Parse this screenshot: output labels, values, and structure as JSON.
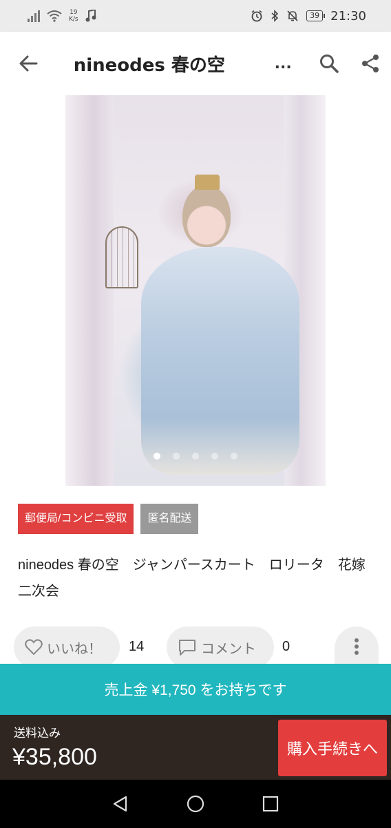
{
  "status_bar": {
    "net_speed_value": "19",
    "net_speed_unit": "K/s",
    "battery": "39",
    "time": "21:30",
    "icons": [
      "signal-icon",
      "wifi-icon",
      "music-icon",
      "alarm-icon",
      "bluetooth-icon",
      "mute-icon",
      "battery-icon"
    ]
  },
  "app_bar": {
    "title": "nineodes 春の空",
    "ellipsis": "...",
    "icons": [
      "back-arrow-icon",
      "search-icon",
      "share-icon"
    ]
  },
  "gallery": {
    "dot_count": 5,
    "active_index": 0
  },
  "tags": {
    "delivery": "郵便局/コンビニ受取",
    "anonymous": "匿名配送"
  },
  "item": {
    "title": "nineodes 春の空　ジャンパースカート　ロリータ　花嫁　二次会"
  },
  "actions": {
    "like_label": "いいね！",
    "like_count": "14",
    "comment_label": "コメント",
    "comment_count": "0"
  },
  "balance_banner": "売上金 ¥1,750 をお持ちです",
  "purchase": {
    "shipping_label": "送料込み",
    "price": "¥35,800",
    "buy_button": "購入手続きへ"
  },
  "colors": {
    "teal": "#21b7bf",
    "red": "#e33d3d",
    "dark": "#2f2622",
    "tag_red": "#e04040",
    "tag_gray": "#999999"
  }
}
